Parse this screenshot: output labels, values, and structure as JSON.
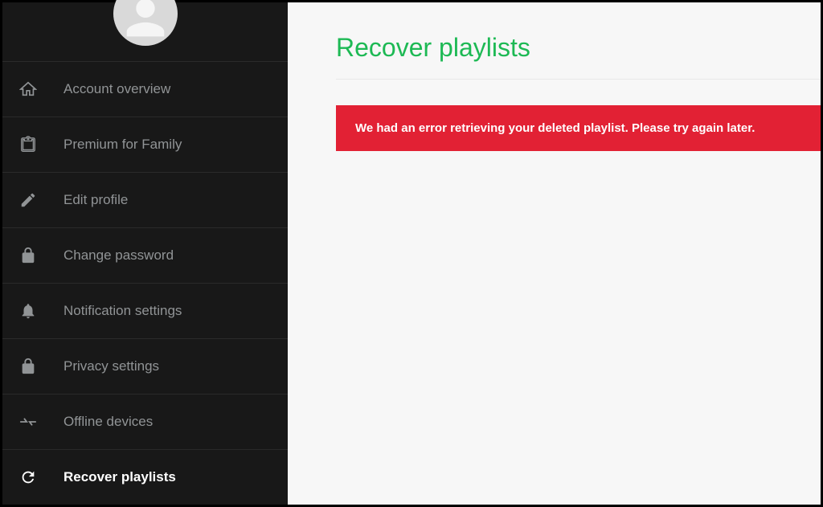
{
  "sidebar": {
    "items": [
      {
        "label": "Account overview"
      },
      {
        "label": "Premium for Family"
      },
      {
        "label": "Edit profile"
      },
      {
        "label": "Change password"
      },
      {
        "label": "Notification settings"
      },
      {
        "label": "Privacy settings"
      },
      {
        "label": "Offline devices"
      },
      {
        "label": "Recover playlists"
      }
    ]
  },
  "main": {
    "title": "Recover playlists",
    "error_message": "We had an error retrieving your deleted playlist. Please try again later."
  }
}
